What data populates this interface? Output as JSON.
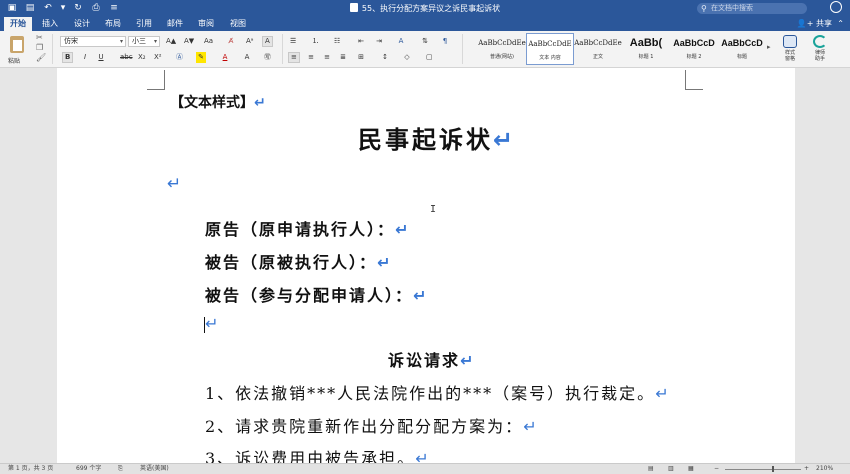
{
  "titlebar": {
    "document_title": "55、执行分配方案异议之诉民事起诉状",
    "search_placeholder": "在文档中搜索",
    "colors": {
      "bar": "#2b579a"
    }
  },
  "quick_access": [
    "sidebar-toggle-icon",
    "save-icon",
    "undo-icon",
    "redo-icon",
    "print-icon",
    "customize-icon"
  ],
  "tabs": {
    "active_index": 0,
    "items": [
      "开始",
      "插入",
      "设计",
      "布局",
      "引用",
      "邮件",
      "审阅",
      "视图"
    ],
    "share_label": "共享"
  },
  "ribbon": {
    "paste_label": "粘贴",
    "font_name": "仿宋",
    "font_size": "小三",
    "font_buttons": [
      "A▲",
      "A▼",
      "Aa",
      "Aᵃ",
      "A"
    ],
    "format_buttons": [
      "B",
      "I",
      "U",
      "abc",
      "X₂",
      "X²"
    ],
    "styles": [
      {
        "sample": "AaBbCcDdEe",
        "name": "普通(网站)"
      },
      {
        "sample": "AaBbCcDdE",
        "name": "文本 内容"
      },
      {
        "sample": "AaBbCcDdEe",
        "name": "正文"
      },
      {
        "sample": "AaBb(",
        "name": "标题 1"
      },
      {
        "sample": "AaBbCcD",
        "name": "标题 2"
      },
      {
        "sample": "AaBbCcD",
        "name": "标题"
      }
    ],
    "selected_style_index": 1,
    "styles_pane_label": "样式\n窗格",
    "assistant_label": "律师\n助手"
  },
  "document": {
    "style_tag": "【文本样式】",
    "heading": "民事起诉状",
    "parties": [
      "原告（原申请执行人）：",
      "被告（原被执行人）：",
      "被告（参与分配申请人）："
    ],
    "claims_heading": "诉讼请求",
    "claims": [
      "1、依法撤销***人民法院作出的***（案号）执行裁定。",
      "2、请求贵院重新作出分配分配方案为：",
      "3、诉讼费用由被告承担。"
    ],
    "paragraph_mark": "↵"
  },
  "status": {
    "page": "第 1 页，共 3 页",
    "words": "699 个字",
    "language": "英语(美国)",
    "zoom": "210%"
  }
}
